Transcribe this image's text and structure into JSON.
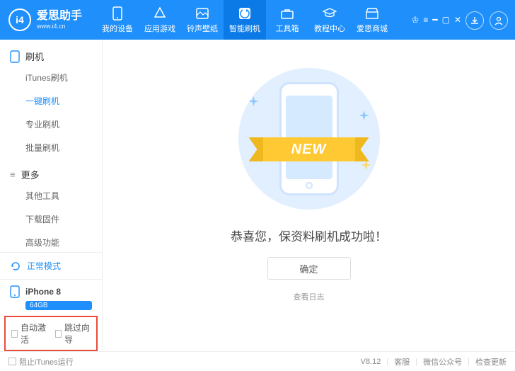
{
  "header": {
    "logo_badge": "i4",
    "logo_text": "爱思助手",
    "logo_url": "www.i4.cn",
    "navs": [
      {
        "label": "我的设备",
        "icon": "phone"
      },
      {
        "label": "应用游戏",
        "icon": "apps"
      },
      {
        "label": "铃声壁纸",
        "icon": "wallpaper"
      },
      {
        "label": "智能刷机",
        "icon": "flash",
        "active": true
      },
      {
        "label": "工具箱",
        "icon": "toolbox"
      },
      {
        "label": "教程中心",
        "icon": "tutorial"
      },
      {
        "label": "爱思商城",
        "icon": "store"
      }
    ]
  },
  "sidebar": {
    "group1_label": "刷机",
    "items1": [
      {
        "label": "iTunes刷机"
      },
      {
        "label": "一键刷机",
        "active": true
      },
      {
        "label": "专业刷机"
      },
      {
        "label": "批量刷机"
      }
    ],
    "group2_label": "更多",
    "items2": [
      {
        "label": "其他工具"
      },
      {
        "label": "下载固件"
      },
      {
        "label": "高级功能"
      }
    ],
    "status_text": "正常模式",
    "device_name": "iPhone 8",
    "device_storage": "64GB",
    "check1": "自动激活",
    "check2": "跳过向导"
  },
  "main": {
    "ribbon_text": "NEW",
    "success_msg": "恭喜您，保资料刷机成功啦！",
    "ok_button": "确定",
    "view_log": "查看日志"
  },
  "footer": {
    "stop_itunes": "阻止iTunes运行",
    "version": "V8.12",
    "support": "客服",
    "wechat": "微信公众号",
    "update": "检查更新"
  }
}
